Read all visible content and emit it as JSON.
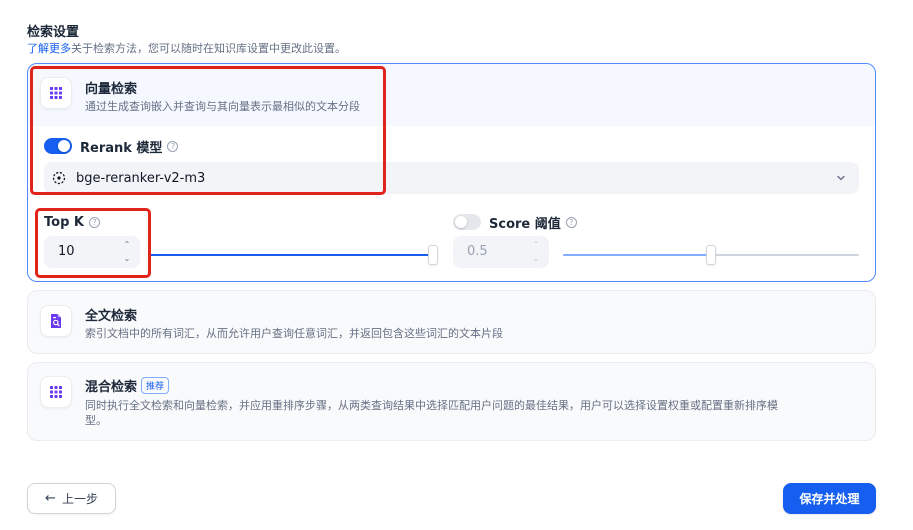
{
  "section": {
    "title": "检索设置",
    "desc_link": "了解更多",
    "desc_text": "关于检索方法，您可以随时在知识库设置中更改此设置。"
  },
  "vector": {
    "title": "向量检索",
    "desc": "通过生成查询嵌入并查询与其向量表示最相似的文本分段",
    "icon": "grid-icon",
    "rerank_label": "Rerank 模型",
    "rerank_enabled": true,
    "model_name": "bge-reranker-v2-m3",
    "top_k_label": "Top K",
    "top_k_value": "10",
    "top_k_fraction": 1.0,
    "score_label": "Score 阈值",
    "score_enabled": false,
    "score_value": "0.5",
    "score_fraction": 0.5
  },
  "fulltext": {
    "title": "全文检索",
    "desc": "索引文档中的所有词汇，从而允许用户查询任意词汇，并返回包含这些词汇的文本片段",
    "icon": "doc-search-icon"
  },
  "hybrid": {
    "title": "混合检索",
    "badge": "推荐",
    "desc_line1": "同时执行全文检索和向量检索，并应用重排序步骤，从两类查询结果中选择匹配用户问题的最佳结果，用户可以选择设置权重或配置重新排序模",
    "desc_line2": "型。",
    "icon": "grid-icon"
  },
  "footer": {
    "prev_label": "上一步",
    "save_label": "保存并处理"
  },
  "colors": {
    "accent": "#155eef",
    "icon_purple": "#6938ef",
    "highlight": "#e0231b"
  }
}
